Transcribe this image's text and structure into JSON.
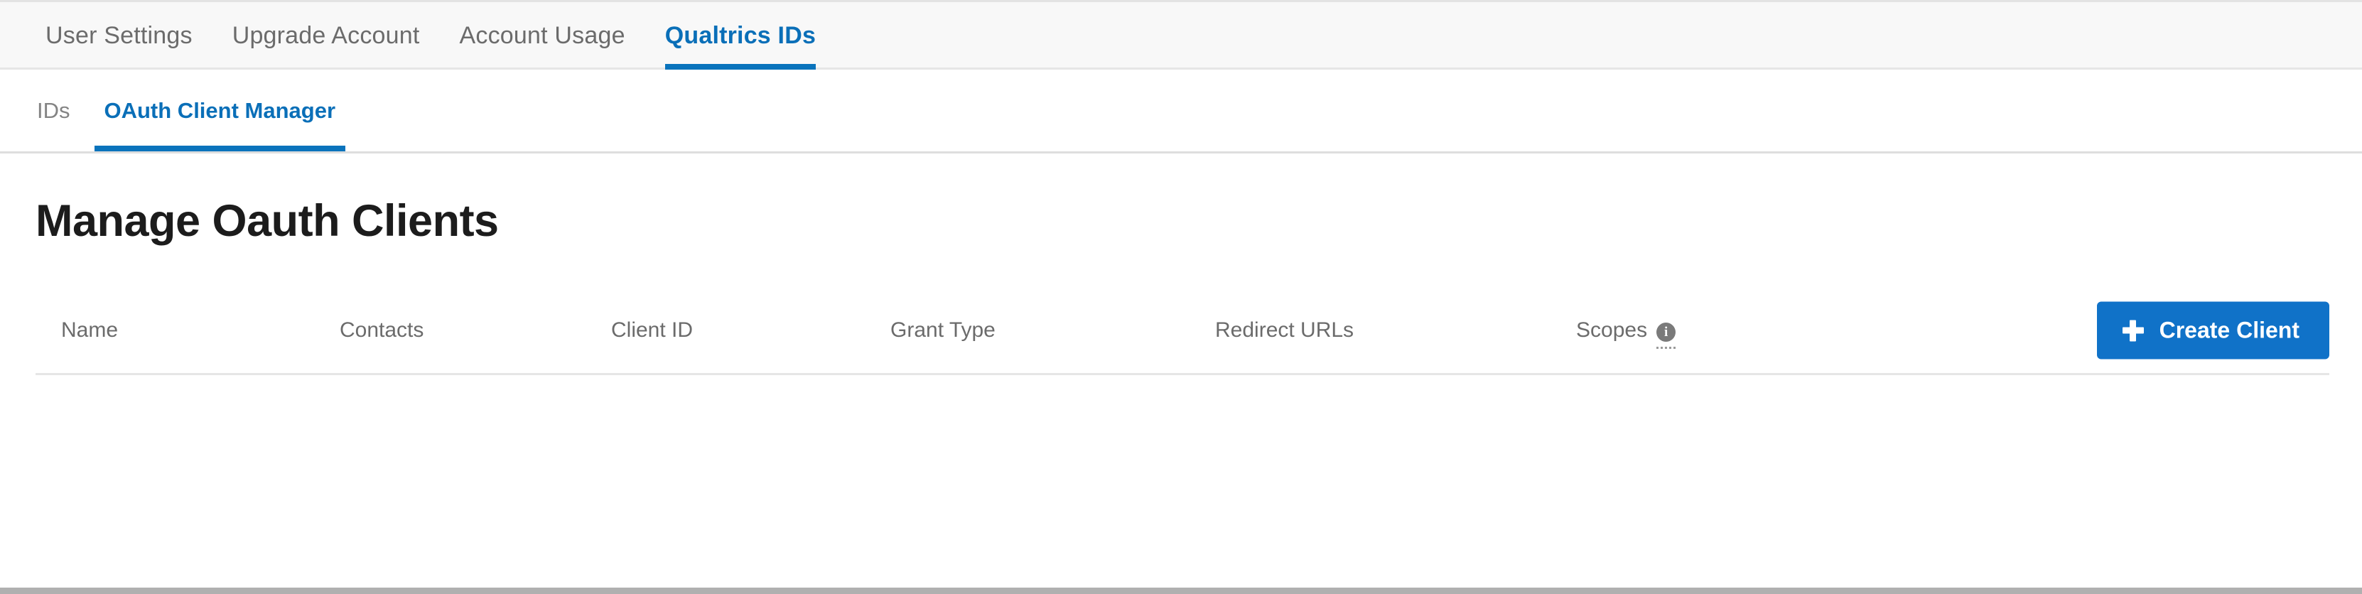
{
  "primary_nav": {
    "tabs": [
      {
        "label": "User Settings",
        "active": false
      },
      {
        "label": "Upgrade Account",
        "active": false
      },
      {
        "label": "Account Usage",
        "active": false
      },
      {
        "label": "Qualtrics IDs",
        "active": true
      }
    ]
  },
  "secondary_nav": {
    "tabs": [
      {
        "label": "IDs",
        "active": false
      },
      {
        "label": "OAuth Client Manager",
        "active": true
      }
    ]
  },
  "main": {
    "page_title": "Manage Oauth Clients",
    "table": {
      "columns": [
        {
          "key": "name",
          "label": "Name"
        },
        {
          "key": "contacts",
          "label": "Contacts"
        },
        {
          "key": "client_id",
          "label": "Client ID"
        },
        {
          "key": "grant_type",
          "label": "Grant Type"
        },
        {
          "key": "redirect_urls",
          "label": "Redirect URLs"
        },
        {
          "key": "scopes",
          "label": "Scopes"
        }
      ],
      "scopes_info_icon": "info-icon",
      "rows": []
    },
    "create_button": {
      "label": "Create Client",
      "icon": "plus-icon"
    }
  },
  "colors": {
    "accent_blue": "#0a73bc",
    "button_blue": "#1072c8",
    "nav_background": "#f8f8f8",
    "text_muted": "#6b6b6b",
    "heading": "#1c1c1c",
    "divider": "#e6e6e6",
    "bottom_bar": "#b0b0b0"
  }
}
